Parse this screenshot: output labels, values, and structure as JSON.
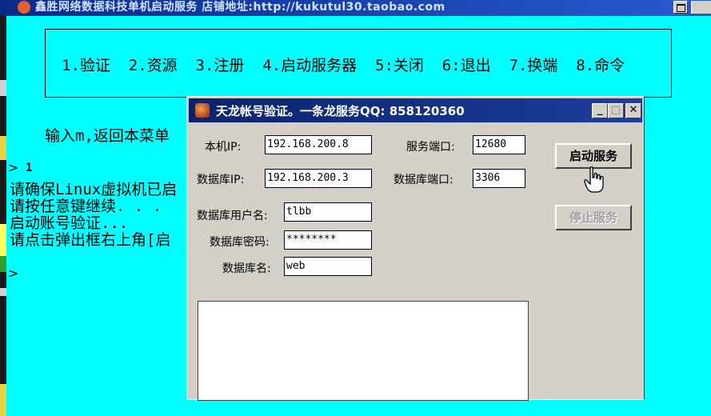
{
  "main_window": {
    "title": "鑫胜网络数据科技单机启动服务  店铺地址:http://kukutul30.taobao.com"
  },
  "menu": {
    "text": "1.验证  2.资源  3.注册  4.启动服务器  5:关闭  6:退出  7.换端  8.命令"
  },
  "console": {
    "hint": "输入m,返回本菜单",
    "prompt_1": "1",
    "lines": [
      "请确保Linux虚拟机已启",
      "请按任意键继续. . .",
      "启动账号验证...",
      "请点击弹出框右上角[启"
    ]
  },
  "dialog": {
    "title": "天龙帐号验证。一条龙服务QQ: 858120360",
    "labels": {
      "local_ip": "本机IP:",
      "db_ip": "数据库IP:",
      "db_user": "数据库用户名:",
      "db_password": "数据库密码:",
      "db_name": "数据库名:",
      "service_port": "服务端口:",
      "db_port": "数据库端口:"
    },
    "values": {
      "local_ip": "192.168.200.8",
      "db_ip": "192.168.200.3",
      "db_user": "tlbb",
      "db_password": "********",
      "db_name": "web",
      "service_port": "12680",
      "db_port": "3306"
    },
    "buttons": {
      "start": "启动服务",
      "stop": "停止服务"
    },
    "window_buttons": {
      "minimize": "_",
      "maximize": "□",
      "close": "✕"
    }
  },
  "colors": {
    "console_bg": "#00ffff",
    "titlebar": "#0a246a",
    "dialog_bg": "#d4d0c8"
  }
}
